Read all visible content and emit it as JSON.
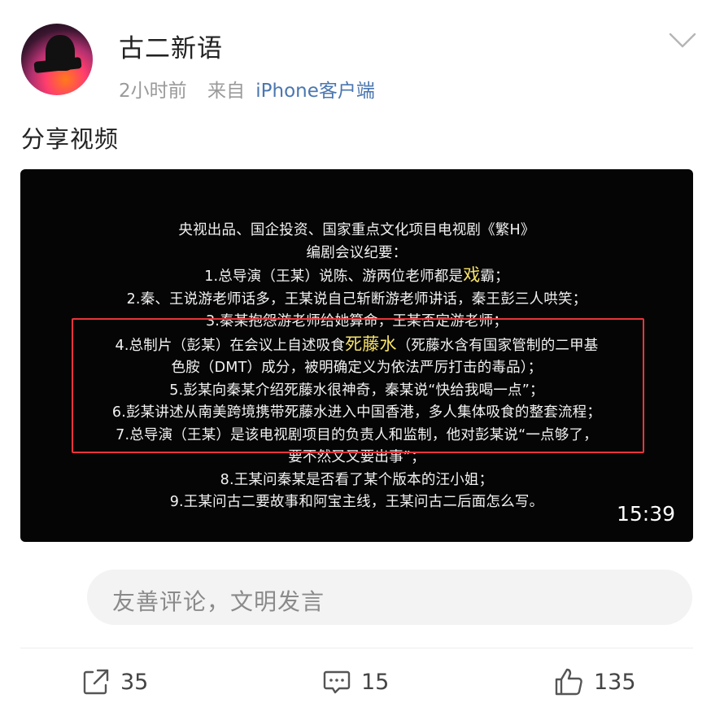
{
  "post": {
    "username": "古二新语",
    "time": "2小时前",
    "source_prefix": "来自",
    "source_device": "iPhone客户端",
    "text": "分享视频"
  },
  "video": {
    "lines": [
      "央视出品、国企投资、国家重点文化项目电视剧《繁H》",
      "编剧会议纪要：",
      "1.总导演（王某）说陈、游两位老师都是",
      "2.秦、王说游老师话多，王某说自己斩断游老师讲话，秦王彭三人哄笑；",
      "3.秦某抱怨游老师给她算命，王某否定游老师；",
      "4.总制片（彭某）在会议上自述吸食",
      "色胺（DMT）成分，被明确定义为依法严厉打击的毒品）；",
      "5.彭某向秦某介绍死藤水很神奇，秦某说“快给我喝一点”；",
      "6.彭某讲述从南美跨境携带死藤水进入中国香港，多人集体吸食的整套流程；",
      "7.总导演（王某）是该电视剧项目的负责人和监制，他对彭某说“一点够了，",
      "要不然又又要出事”；",
      "8.王某问秦某是否看了某个版本的汪小姐；",
      "9.王某问古二要故事和阿宝主线，王某问古二后面怎么写。"
    ],
    "line1_highlight": "戏",
    "line1_tail": "霸；",
    "line4_highlight": "死藤水",
    "line4_tail": "（死藤水含有国家管制的二甲基",
    "duration": "15:39",
    "highlight_color": "#f7e36b"
  },
  "comment": {
    "placeholder": "友善评论，文明发言"
  },
  "actions": {
    "share_count": "35",
    "comment_count": "15",
    "like_count": "135"
  },
  "icons": {
    "menu": "chevron-down-icon",
    "share": "share-icon",
    "comment": "comment-icon",
    "like": "thumbs-up-icon"
  },
  "colors": {
    "accent_link": "#4a76b0",
    "annotation_box": "#e8353b"
  }
}
